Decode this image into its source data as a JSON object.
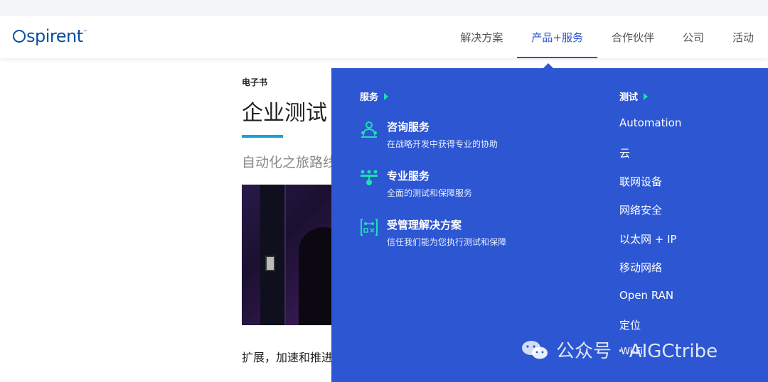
{
  "header": {
    "logo_text": "spirent",
    "logo_tm": "™",
    "nav": [
      "解决方案",
      "产品+服务",
      "合作伙伴",
      "公司",
      "活动"
    ],
    "active_index": 1
  },
  "article": {
    "eyebrow": "电子书",
    "title": "企业测试",
    "subtitle": "自动化之旅路线",
    "body_text": "扩展，加速和推进"
  },
  "dropdown": {
    "services_heading": "服务",
    "services": [
      {
        "title": "咨询服务",
        "desc": "在战略开发中获得专业的协助",
        "icon": "consulting-icon"
      },
      {
        "title": "专业服务",
        "desc": "全面的测试和保障服务",
        "icon": "professional-services-icon"
      },
      {
        "title": "受管理解决方案",
        "desc": "信任我们能为您执行测试和保障",
        "icon": "managed-solutions-icon"
      }
    ],
    "testing_heading": "测试",
    "testing_items": [
      "Automation",
      "云",
      "联网设备",
      "网络安全",
      "以太网 + IP",
      "移动网络",
      "Open RAN",
      "定位"
    ],
    "overlay_item": "Wi-Fi"
  },
  "watermark": {
    "text": "公众号 · AIGCtribe",
    "icon": "wechat-icon"
  },
  "colors": {
    "brand_blue": "#0a4fa3",
    "dropdown_bg": "#2c56d2",
    "accent_teal": "#1ee0b0",
    "rule_cyan": "#13a3d8"
  }
}
